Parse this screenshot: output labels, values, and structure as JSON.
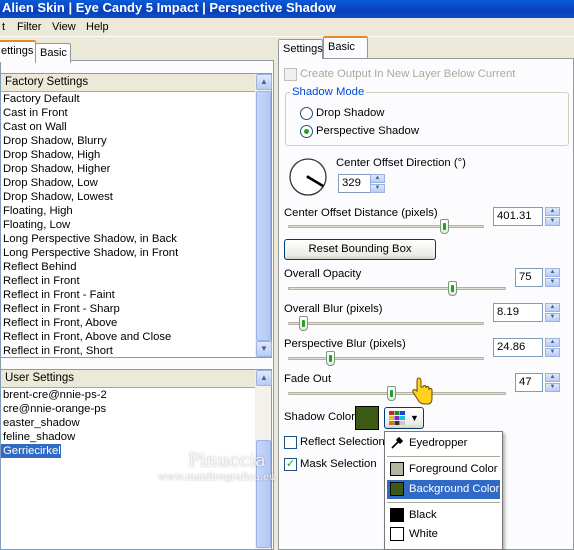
{
  "window": {
    "title": "Alien Skin  |  Eye Candy 5 Impact  |  Perspective Shadow"
  },
  "menu": [
    "t",
    "Filter",
    "View",
    "Help"
  ],
  "left": {
    "tabs": [
      "ettings",
      "Basic"
    ],
    "factory": {
      "header": "Factory Settings",
      "items": [
        "Factory Default",
        "Cast in Front",
        "Cast on Wall",
        "Drop Shadow, Blurry",
        "Drop Shadow, High",
        "Drop Shadow, Higher",
        "Drop Shadow, Low",
        "Drop Shadow, Lowest",
        "Floating, High",
        "Floating, Low",
        "Long Perspective Shadow, in Back",
        "Long Perspective Shadow, in Front",
        "Reflect Behind",
        "Reflect in Front",
        "Reflect in Front - Faint",
        "Reflect in Front - Sharp",
        "Reflect in Front, Above",
        "Reflect in Front, Above and Close",
        "Reflect in Front, Short"
      ]
    },
    "user": {
      "header": "User Settings",
      "items": [
        "brent-cre@nnie-ps-2",
        "cre@nnie-orange-ps",
        "easter_shadow",
        "feline_shadow",
        "Gerriecirkel"
      ],
      "selected_index": 4
    }
  },
  "right": {
    "tabs": [
      "Settings",
      "Basic"
    ],
    "create_output_label": "Create Output In New Layer Below Current",
    "shadow_mode": {
      "title": "Shadow Mode",
      "options": [
        "Drop Shadow",
        "Perspective Shadow"
      ],
      "selected": "Perspective Shadow"
    },
    "center_offset_direction": {
      "label": "Center Offset Direction (°)",
      "value": "329"
    },
    "center_offset_distance": {
      "label": "Center Offset Distance (pixels)",
      "value": "401.31",
      "level": 0.93
    },
    "reset_button": "Reset Bounding Box",
    "overall_opacity": {
      "label": "Overall Opacity",
      "value": "75",
      "level": 0.75
    },
    "overall_blur": {
      "label": "Overall Blur (pixels)",
      "value": "8.19",
      "level": 0.08
    },
    "perspective_blur": {
      "label": "Perspective Blur (pixels)",
      "value": "24.86",
      "level": 0.2
    },
    "fade_out": {
      "label": "Fade Out",
      "value": "47",
      "level": 0.47
    },
    "shadow_color": {
      "label": "Shadow Color",
      "value": "#3c5a14"
    },
    "reflect_selection": {
      "label": "Reflect Selection",
      "checked": false
    },
    "mask_selection": {
      "label": "Mask Selection",
      "checked": true
    }
  },
  "popup": {
    "eyedropper": "Eyedropper",
    "items": [
      {
        "label": "Foreground Color",
        "color": "#b4b4a0"
      },
      {
        "label": "Background Color",
        "color": "#3c5a14"
      },
      {
        "label": "Black",
        "color": "#000000"
      },
      {
        "label": "White",
        "color": "#ffffff"
      }
    ],
    "highlighted_index": 1
  },
  "watermark": {
    "title": "Pinuccia",
    "url": "www.maidiregrafica.eu"
  }
}
